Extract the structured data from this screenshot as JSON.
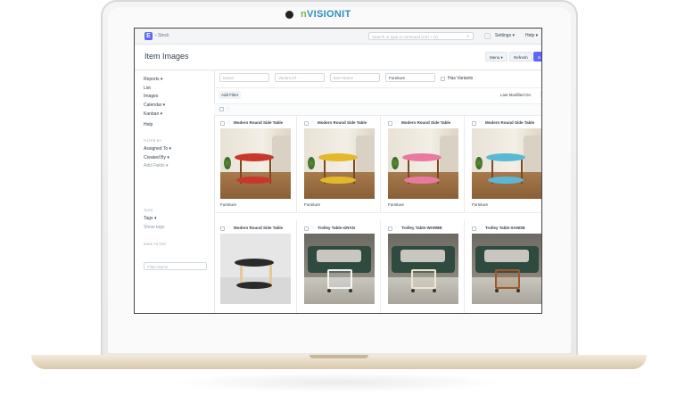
{
  "laptop": {
    "brand_prefix": "n",
    "brand_name": "VISIONIT"
  },
  "app": {
    "logo_letter": "E",
    "breadcrumb": "Stock",
    "search_placeholder": "Search or type a command (Ctrl + G)",
    "nav": {
      "settings": "Settings",
      "help": "Help"
    }
  },
  "page": {
    "title": "Item Images",
    "menu_button": "Menu",
    "refresh_button": "Refresh",
    "new_button": "N"
  },
  "sidebar": {
    "items": [
      {
        "label": "Reports",
        "has_caret": true
      },
      {
        "label": "List",
        "has_caret": false
      },
      {
        "label": "Images",
        "has_caret": false
      },
      {
        "label": "Calendar",
        "has_caret": true
      },
      {
        "label": "Kanban",
        "has_caret": true
      }
    ],
    "help": "Help",
    "filter_by_label": "FILTER BY",
    "filters": [
      {
        "label": "Assigned To",
        "has_caret": true
      },
      {
        "label": "Created By",
        "has_caret": true
      },
      {
        "label": "Add Fields",
        "has_caret": true
      }
    ],
    "tags_label": "TAGS",
    "tags": {
      "label": "Tags",
      "has_caret": true
    },
    "show_tags": "Show tags",
    "save_filter_label": "SAVE FILTER",
    "filter_name_placeholder": "Filter Name"
  },
  "filters": {
    "name_placeholder": "Name",
    "variant_of_placeholder": "Variant Of",
    "item_name_placeholder": "Item Name",
    "item_group_value": "Furniture",
    "has_variants_label": "Has Variants",
    "add_filter": "Add Filter",
    "sort_label": "Last Modified On"
  },
  "colors": {
    "primary": "#5e64ff"
  },
  "cards": [
    {
      "title": "Modern Round Side Table",
      "group": "Furniture",
      "color": "#c8372b",
      "kind": "round"
    },
    {
      "title": "Modern Round Side Table",
      "group": "Furniture",
      "color": "#e3b92a",
      "kind": "round"
    },
    {
      "title": "Modern Round Side Table",
      "group": "Furniture",
      "color": "#e87aa0",
      "kind": "round"
    },
    {
      "title": "Modern Round Side Table",
      "group": "Furniture",
      "color": "#5ab8d6",
      "kind": "round"
    },
    {
      "title": "Modern Round Side Table",
      "group": "",
      "color": "#2a2a2a",
      "kind": "round-dark"
    },
    {
      "title": "Trolley Table-GRAN",
      "group": "",
      "color": "#f4f4f4",
      "kind": "trolley"
    },
    {
      "title": "Trolley Table-WARBB",
      "group": "",
      "color": "#efe6d0",
      "kind": "trolley"
    },
    {
      "title": "Trolley Table-SANDB",
      "group": "",
      "color": "#9c5a2a",
      "kind": "trolley"
    }
  ]
}
